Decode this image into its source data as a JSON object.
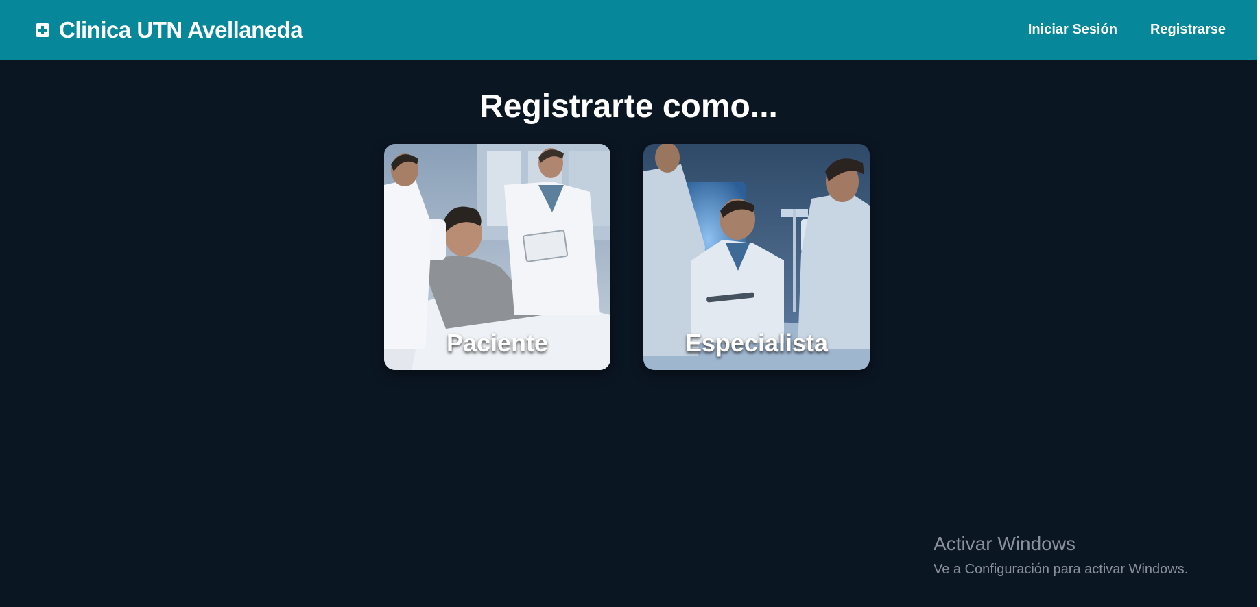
{
  "navbar": {
    "icon": "medical-cross-icon",
    "brand_title": "Clinica UTN Avellaneda",
    "links": [
      {
        "label": "Iniciar Sesión"
      },
      {
        "label": "Registrarse"
      }
    ],
    "background_color": "#07879a"
  },
  "main": {
    "heading": "Registrarte como...",
    "cards": [
      {
        "label": "Paciente",
        "image": "patient-in-hospital-bed-with-doctors"
      },
      {
        "label": "Especialista",
        "image": "doctors-consulting-in-hospital-room"
      }
    ]
  },
  "watermark": {
    "title": "Activar Windows",
    "subtitle": "Ve a Configuración para activar Windows."
  },
  "colors": {
    "page_background": "#0b1623",
    "accent": "#07879a"
  }
}
